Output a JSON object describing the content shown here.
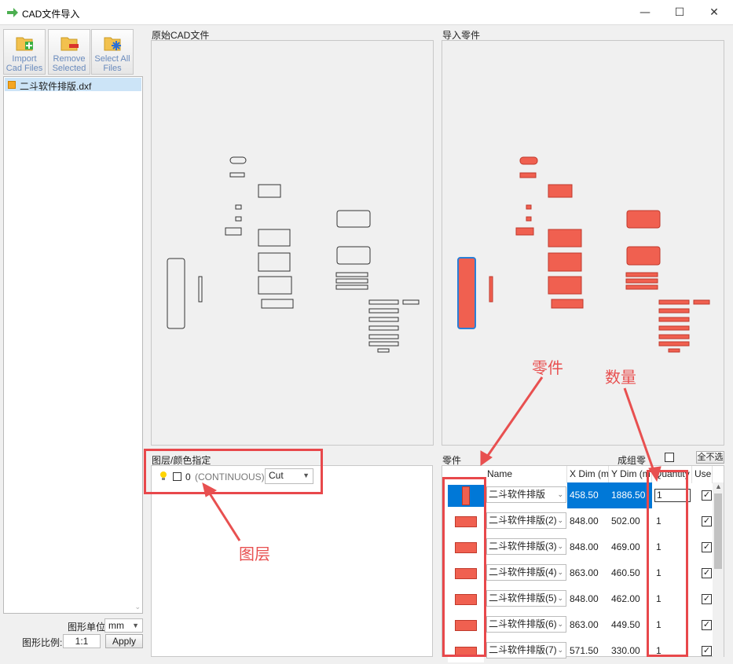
{
  "window": {
    "title": "CAD文件导入",
    "minimize": "—",
    "maximize": "☐",
    "close": "✕"
  },
  "toolbar": {
    "import_label": "Import Cad Files",
    "remove_label": "Remove Selected",
    "select_label": "Select All Files"
  },
  "file_list": {
    "items": [
      "二斗软件排版.dxf"
    ]
  },
  "bottom_left": {
    "unit_label": "图形单位",
    "unit_value": "mm",
    "scale_label": "图形比例:",
    "scale_value": "1:1",
    "apply_label": "Apply"
  },
  "panels": {
    "original_title": "原始CAD文件",
    "imported_title": "导入零件",
    "layers_title": "图层/颜色指定",
    "parts_title": "零件"
  },
  "layers": {
    "items": [
      {
        "name": "0",
        "linetype": "(CONTINUOUS)",
        "mode": "Cut"
      }
    ]
  },
  "parts_controls": {
    "group_label": "成组零",
    "deselect_all": "全不选"
  },
  "grid": {
    "headers": [
      "Name",
      "X Dim (m",
      "Y Dim (m",
      "Quantity",
      "Use"
    ],
    "rows": [
      {
        "name": "二斗软件排版",
        "x": "458.50",
        "y": "1886.50",
        "qty": "1",
        "use": "✓"
      },
      {
        "name": "二斗软件排版(2)",
        "x": "848.00",
        "y": "502.00",
        "qty": "1",
        "use": "✓"
      },
      {
        "name": "二斗软件排版(3)",
        "x": "848.00",
        "y": "469.00",
        "qty": "1",
        "use": "✓"
      },
      {
        "name": "二斗软件排版(4)",
        "x": "863.00",
        "y": "460.50",
        "qty": "1",
        "use": "✓"
      },
      {
        "name": "二斗软件排版(5)",
        "x": "848.00",
        "y": "462.00",
        "qty": "1",
        "use": "✓"
      },
      {
        "name": "二斗软件排版(6)",
        "x": "863.00",
        "y": "449.50",
        "qty": "1",
        "use": "✓"
      },
      {
        "name": "二斗软件排版(7)",
        "x": "571.50",
        "y": "330.00",
        "qty": "1",
        "use": "✓"
      }
    ]
  },
  "annotations": {
    "parts": "零件",
    "quantity": "数量",
    "layer": "图层"
  },
  "colors": {
    "accent": "#0078d7",
    "part_fill": "#f06050",
    "annotation_red": "#e8484b"
  }
}
